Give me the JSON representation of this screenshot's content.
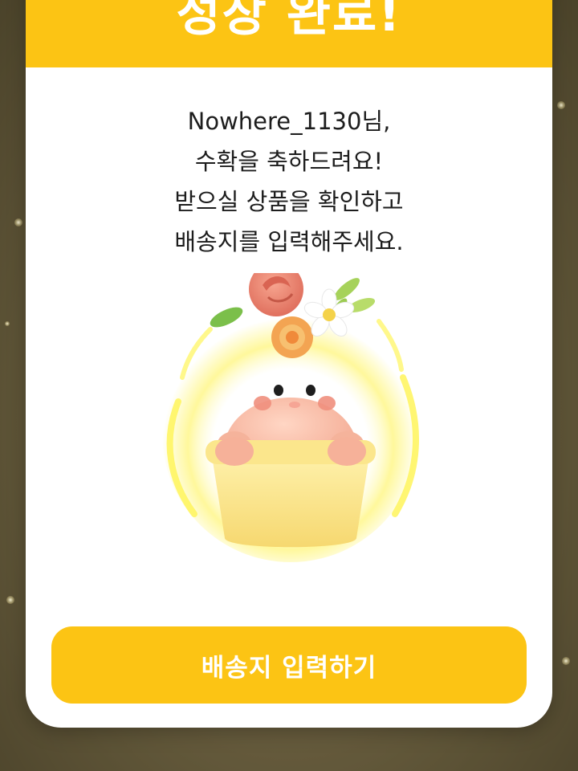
{
  "modal": {
    "title": "성장 완료!",
    "message_lines": [
      "Nowhere_1130님,",
      "수확을 축하드려요!",
      "받으실 상품을 확인하고",
      "배송지를 입력해주세요."
    ],
    "button_label": "배송지 입력하기"
  },
  "colors": {
    "accent": "#fcc414",
    "text": "#1d1d1d",
    "button_text": "#ffffff"
  },
  "illustration": {
    "icon": "potted-flower-character-icon"
  }
}
